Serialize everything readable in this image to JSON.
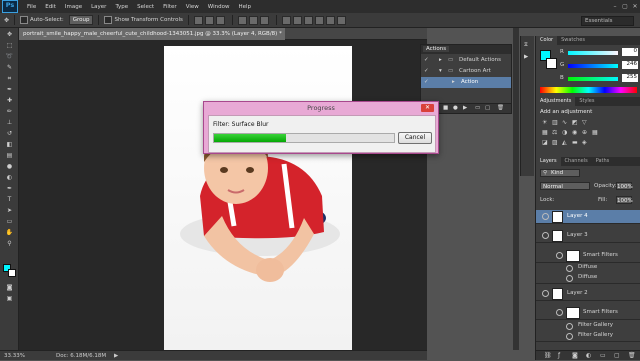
{
  "menubar": {
    "logo": "Ps",
    "items": [
      "File",
      "Edit",
      "Image",
      "Layer",
      "Type",
      "Select",
      "Filter",
      "View",
      "Window",
      "Help"
    ],
    "win_controls": [
      "–",
      "▢",
      "✕"
    ]
  },
  "options": {
    "auto_select_label": "Auto-Select:",
    "group_value": "Group",
    "transform_label": "Show Transform Controls",
    "workspace": "Essentials"
  },
  "document": {
    "tab_title": "portrait_smile_happy_male_cheerful_cute_childhood-1343051.jpg @ 33.3% (Layer 4, RGB/8) *",
    "close": "×",
    "zoom": "33.33%",
    "doc_size": "Doc: 6.18M/6.18M"
  },
  "actions_panel": {
    "title": "Actions",
    "rows": [
      {
        "label": "Default Actions"
      },
      {
        "label": "Cartoon Art"
      },
      {
        "label": "Action"
      }
    ]
  },
  "color_panel": {
    "tabs": [
      "Color",
      "Swatches"
    ],
    "channels": [
      {
        "name": "R",
        "value": "0"
      },
      {
        "name": "G",
        "value": "246"
      },
      {
        "name": "B",
        "value": "255"
      }
    ],
    "foreground": "#00f6ff"
  },
  "adjustments_panel": {
    "tabs": [
      "Adjustments",
      "Styles"
    ],
    "heading": "Add an adjustment"
  },
  "layers_panel": {
    "tabs": [
      "Layers",
      "Channels",
      "Paths"
    ],
    "kind_label": "Kind",
    "blend_mode": "Normal",
    "opacity_label": "Opacity:",
    "opacity_value": "100%",
    "lock_label": "Lock:",
    "fill_label": "Fill:",
    "fill_value": "100%",
    "layers": [
      {
        "name": "Layer 4",
        "selected": true
      },
      {
        "name": "Layer 3"
      },
      {
        "name": "Smart Filters"
      },
      {
        "name": "Diffuse"
      },
      {
        "name": "Diffuse"
      },
      {
        "name": "Layer 2"
      },
      {
        "name": "Smart Filters"
      },
      {
        "name": "Filter Gallery"
      },
      {
        "name": "Filter Gallery"
      }
    ]
  },
  "progress_dialog": {
    "title": "Progress",
    "close": "✕",
    "filter_text": "Filter: Surface Blur",
    "progress": 0.4,
    "cancel_label": "Cancel"
  },
  "colors": {
    "accent_cyan": "#00f6ff",
    "progress_green": "#0cbf0c",
    "dialog_pink": "#e8a9d5"
  }
}
